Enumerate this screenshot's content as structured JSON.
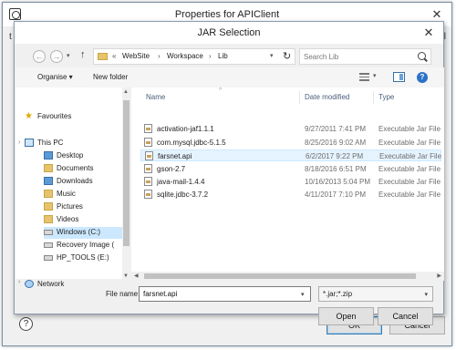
{
  "outer_window": {
    "title": "Properties for APIClient",
    "close_glyph": "✕",
    "side_char_left": "t",
    "side_char_right": "l",
    "help_glyph": "?",
    "ok_label": "OK",
    "cancel_label": "Cancel"
  },
  "dialog": {
    "title": "JAR Selection",
    "close_glyph": "✕"
  },
  "navigation": {
    "back_glyph": "←",
    "forward_glyph": "→",
    "dropdown_glyph": "▾",
    "up_glyph": "↑",
    "breadcrumb_prefix": "«",
    "breadcrumbs": [
      "WebSite",
      "Workspace",
      "Lib"
    ],
    "separator": "›",
    "address_caret": "▾",
    "refresh_glyph": "↻"
  },
  "search": {
    "placeholder": "Search Lib"
  },
  "toolbar": {
    "organise_label": "Organise ▾",
    "new_folder_label": "New folder",
    "view_caret": "▾",
    "help_glyph": "?"
  },
  "sidebar": {
    "items": [
      {
        "label": "Favourites",
        "icon": "star-icon"
      },
      {
        "label": "This PC",
        "icon": "computer-icon"
      },
      {
        "label": "Desktop",
        "icon": "folder-icon"
      },
      {
        "label": "Documents",
        "icon": "folder-icon"
      },
      {
        "label": "Downloads",
        "icon": "folder-icon"
      },
      {
        "label": "Music",
        "icon": "folder-icon"
      },
      {
        "label": "Pictures",
        "icon": "folder-icon"
      },
      {
        "label": "Videos",
        "icon": "folder-icon"
      },
      {
        "label": "Windows (C:)",
        "icon": "drive-icon"
      },
      {
        "label": "Recovery Image (",
        "icon": "drive-icon"
      },
      {
        "label": "HP_TOOLS (E:)",
        "icon": "drive-icon"
      },
      {
        "label": "Network",
        "icon": "network-icon"
      }
    ],
    "scroll_up": "▲",
    "scroll_down": "▼"
  },
  "file_list": {
    "columns": [
      "Name",
      "Date modified",
      "Type"
    ],
    "sort_arrow": "^",
    "rows": [
      {
        "name": "activation-jaf1.1.1",
        "date": "9/27/2011 7:41 PM",
        "type": "Executable Jar File"
      },
      {
        "name": "com.mysql.jdbc-5.1.5",
        "date": "8/25/2016 9:02 AM",
        "type": "Executable Jar File"
      },
      {
        "name": "farsnet.api",
        "date": "6/2/2017 9:22 PM",
        "type": "Executable Jar File",
        "selected": true
      },
      {
        "name": "gson-2.7",
        "date": "8/18/2016 6:51 PM",
        "type": "Executable Jar File"
      },
      {
        "name": "java-mail-1.4.4",
        "date": "10/16/2013 5:04 PM",
        "type": "Executable Jar File"
      },
      {
        "name": "sqlite.jdbc-3.7.2",
        "date": "4/11/2017 7:10 PM",
        "type": "Executable Jar File"
      }
    ],
    "scroll_left": "◀",
    "scroll_right": "▶"
  },
  "footer": {
    "file_name_label": "File name:",
    "file_name_value": "farsnet.api",
    "file_name_caret": "▾",
    "filter_value": "*.jar;*.zip",
    "filter_caret": "▾",
    "open_label": "Open",
    "cancel_label": "Cancel"
  },
  "colors": {
    "selection": "#cce8ff",
    "accent": "#3c7fb1",
    "folder": "#e6c46b"
  }
}
